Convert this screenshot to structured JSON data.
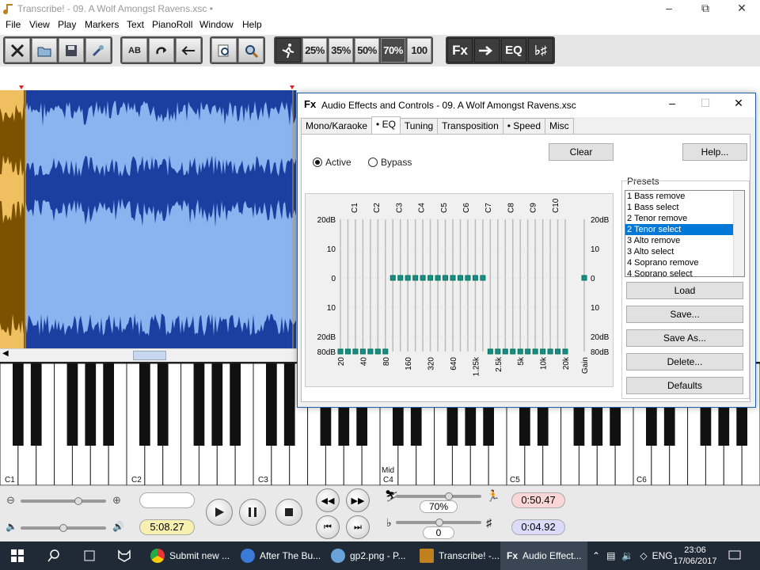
{
  "window": {
    "title": "Transcribe! - 09. A Wolf Amongst Ravens.xsc •"
  },
  "menu": [
    "File",
    "View",
    "Play",
    "Markers",
    "Text",
    "PianoRoll",
    "Window",
    "Help"
  ],
  "toolbar": {
    "speeds": [
      "25%",
      "35%",
      "50%",
      "70%",
      "100"
    ],
    "fx_label": "Fx",
    "eq_label": "EQ"
  },
  "piano": {
    "octaves": [
      "C1",
      "C2",
      "C3",
      "C4",
      "C5",
      "C6"
    ],
    "mid_label": "Mid"
  },
  "bottom": {
    "total_time": "5:08.27",
    "position_time": "0:50.47",
    "loop_time": "0:04.92",
    "speed_value": "70%",
    "transpose_value": "0"
  },
  "dialog": {
    "title": "Audio Effects and Controls - 09. A Wolf Amongst Ravens.xsc",
    "fx_badge": "Fx",
    "tabs": [
      "Mono/Karaoke",
      "• EQ",
      "Tuning",
      "Transposition",
      "• Speed",
      "Misc"
    ],
    "selected_tab": 1,
    "clear_label": "Clear",
    "help_label": "Help...",
    "active_label": "Active",
    "bypass_label": "Bypass",
    "mode": "Active",
    "presets_label": "Presets",
    "presets": [
      "1 Bass remove",
      "1 Bass select",
      "2 Tenor remove",
      "2 Tenor select",
      "3 Alto remove",
      "3 Alto select",
      "4 Soprano remove",
      "4 Soprano select"
    ],
    "selected_preset": "2 Tenor select",
    "load_label": "Load",
    "save_label": "Save...",
    "save_as_label": "Save As...",
    "delete_label": "Delete...",
    "defaults_label": "Defaults",
    "eq": {
      "top_labels": [
        "C1",
        "C2",
        "C3",
        "C4",
        "C5",
        "C6",
        "C7",
        "C8",
        "C9",
        "C10"
      ],
      "left_scale": [
        "20dB",
        "10",
        "0",
        "10",
        "20dB",
        "80dB"
      ],
      "right_scale": [
        "20dB",
        "10",
        "0",
        "10",
        "20dB",
        "80dB"
      ],
      "freq_labels": [
        "20",
        "40",
        "80",
        "160",
        "320",
        "640",
        "1.25k",
        "2.5k",
        "5k",
        "10k",
        "20k"
      ],
      "gain_label": "Gain",
      "band_levels_db": [
        -80,
        -80,
        -80,
        -80,
        -80,
        -80,
        -80,
        0,
        0,
        0,
        0,
        0,
        0,
        0,
        0,
        0,
        0,
        0,
        0,
        0,
        -80,
        -80,
        -80,
        -80,
        -80,
        -80,
        -80,
        -80,
        -80,
        -80,
        -80
      ],
      "gain_db": 0
    }
  },
  "taskbar": {
    "apps": [
      "Submit new ...",
      "After The Bu...",
      "gp2.png - P...",
      "Transcribe! -...",
      "Audio Effect..."
    ],
    "lang": "ENG",
    "time": "23:06",
    "date": "17/06/2017"
  },
  "colors": {
    "wave_fill": "#1a3fa0",
    "wave_bg": "#8ab4f0",
    "accent": "#0078d7"
  }
}
